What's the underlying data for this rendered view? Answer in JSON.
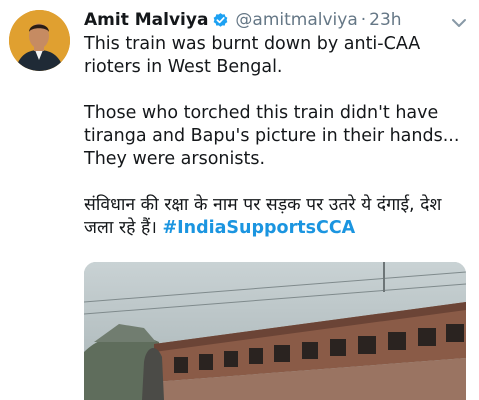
{
  "tweet": {
    "author_name": "Amit Malviya",
    "handle": "@amitmalviya",
    "separator": "·",
    "time": "23h",
    "paragraphs": [
      "This train was burnt down by anti-CAA rioters in West Bengal.",
      "Those who torched this train didn't have tiranga and Bapu's picture in their hands... They were arsonists."
    ],
    "hindi_text": "संविधान की रक्षा के नाम पर सड़क पर उतरे ये दंगाई, देश जला रहे हैं।",
    "hashtag": "#IndiaSupportsCCA",
    "media_icon": "video-thumbnail",
    "icons": [
      "avatar",
      "verified-badge-icon",
      "chevron-down-icon"
    ]
  },
  "colors": {
    "text": "#14171a",
    "secondary": "#657786",
    "accent": "#1b95e0",
    "verified": "#1da1f2"
  }
}
